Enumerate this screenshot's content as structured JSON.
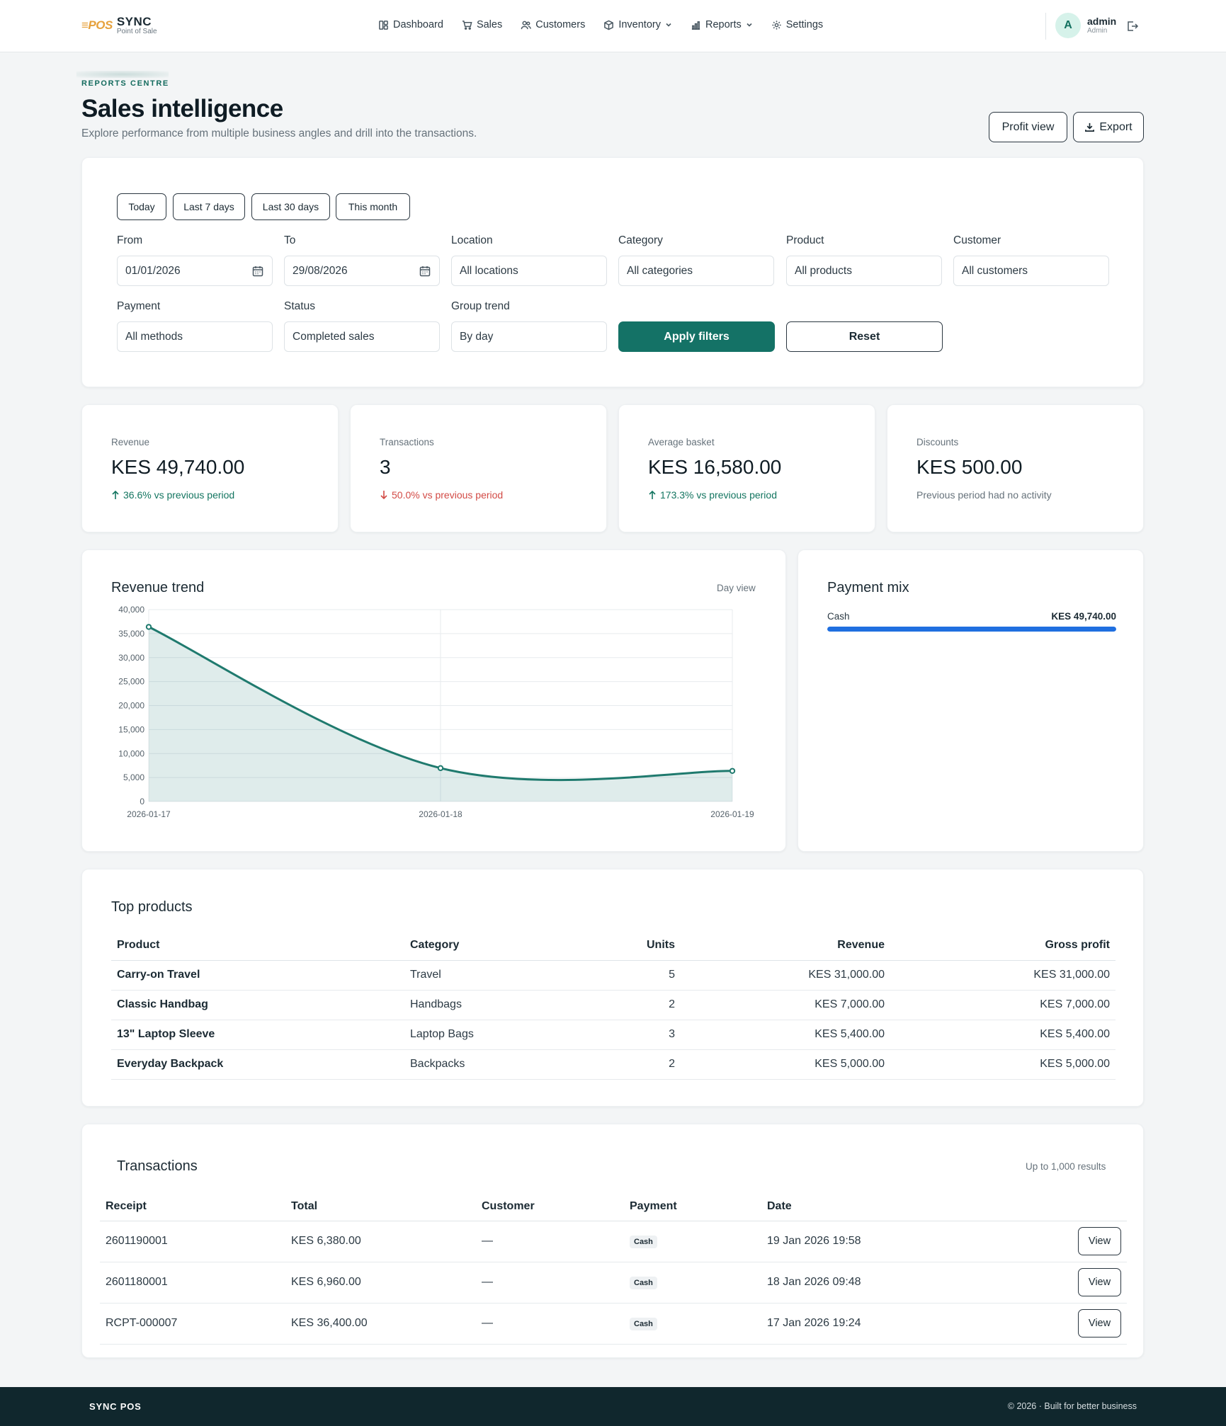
{
  "nav": {
    "brand_logo": "≡POS",
    "brand_name": "SYNC",
    "brand_sub": "Point of Sale",
    "items": [
      {
        "label": "Dashboard",
        "icon": "dashboard-icon"
      },
      {
        "label": "Sales",
        "icon": "cart-icon"
      },
      {
        "label": "Customers",
        "icon": "users-icon"
      },
      {
        "label": "Inventory",
        "icon": "box-icon"
      },
      {
        "label": "Reports",
        "icon": "bar-chart-icon"
      },
      {
        "label": "Settings",
        "icon": "gear-icon"
      }
    ],
    "user": {
      "initial": "A",
      "name": "admin",
      "role": "Admin"
    }
  },
  "header": {
    "eyebrow": "REPORTS CENTRE",
    "title": "Sales intelligence",
    "subtitle": "Explore performance from multiple business angles and drill into the transactions.",
    "profit_label": "Profit view",
    "export_label": "Export"
  },
  "filters": {
    "chips": [
      "Today",
      "Last 7 days",
      "Last 30 days",
      "This month"
    ],
    "from": {
      "label": "From",
      "value": "01/01/2026"
    },
    "to": {
      "label": "To",
      "value": "29/08/2026"
    },
    "location": {
      "label": "Location",
      "value": "All locations"
    },
    "category": {
      "label": "Category",
      "value": "All categories"
    },
    "product": {
      "label": "Product",
      "value": "All products"
    },
    "customer": {
      "label": "Customer",
      "value": "All customers"
    },
    "payment": {
      "label": "Payment",
      "value": "All methods"
    },
    "status": {
      "label": "Status",
      "value": "Completed sales"
    },
    "group": {
      "label": "Group trend",
      "value": "By day"
    },
    "apply_label": "Apply filters",
    "reset_label": "Reset"
  },
  "kpis": [
    {
      "label": "Revenue",
      "value": "KES 49,740.00",
      "delta": "36.6% vs previous period",
      "trend": "up"
    },
    {
      "label": "Transactions",
      "value": "3",
      "delta": "50.0% vs previous period",
      "trend": "down"
    },
    {
      "label": "Average basket",
      "value": "KES 16,580.00",
      "delta": "173.3% vs previous period",
      "trend": "up"
    },
    {
      "label": "Discounts",
      "value": "KES 500.00",
      "delta": "Previous period had no activity",
      "trend": "neutral"
    }
  ],
  "chart_card": {
    "title": "Revenue trend",
    "note": "Day view"
  },
  "chart_data": {
    "type": "area",
    "title": "Revenue trend",
    "x": [
      "2026-01-17",
      "2026-01-18",
      "2026-01-19"
    ],
    "series": [
      {
        "values": [
          36400,
          6960,
          6380
        ]
      }
    ],
    "ylim": [
      0,
      40000
    ],
    "yticks": [
      0,
      5000,
      10000,
      15000,
      20000,
      25000,
      30000,
      35000,
      40000
    ],
    "ytick_labels": [
      "0",
      "5,000",
      "10,000",
      "15,000",
      "20,000",
      "25,000",
      "30,000",
      "35,000",
      "40,000"
    ],
    "grid": true,
    "color": "#1f7a6e"
  },
  "payment_mix": {
    "title": "Payment mix",
    "items": [
      {
        "name": "Cash",
        "amount": "KES 49,740.00",
        "share": 1.0
      }
    ],
    "bar_color": "#1f6fe0"
  },
  "top_products": {
    "title": "Top products",
    "headers": [
      "Product",
      "Category",
      "Units",
      "Revenue",
      "Gross profit"
    ],
    "rows": [
      [
        "Carry-on Travel",
        "Travel",
        "5",
        "KES 31,000.00",
        "KES 31,000.00"
      ],
      [
        "Classic Handbag",
        "Handbags",
        "2",
        "KES 7,000.00",
        "KES 7,000.00"
      ],
      [
        "13\" Laptop Sleeve",
        "Laptop Bags",
        "3",
        "KES 5,400.00",
        "KES 5,400.00"
      ],
      [
        "Everyday Backpack",
        "Backpacks",
        "2",
        "KES 5,000.00",
        "KES 5,000.00"
      ]
    ]
  },
  "transactions": {
    "title": "Transactions",
    "note": "Up to 1,000 results",
    "headers": [
      "Receipt",
      "Total",
      "Customer",
      "Payment",
      "Date"
    ],
    "view_label": "View",
    "rows": [
      [
        "2601190001",
        "KES 6,380.00",
        "—",
        "Cash",
        "19 Jan 2026 19:58"
      ],
      [
        "2601180001",
        "KES 6,960.00",
        "—",
        "Cash",
        "18 Jan 2026 09:48"
      ],
      [
        "RCPT-000007",
        "KES 36,400.00",
        "—",
        "Cash",
        "17 Jan 2026 19:24"
      ]
    ]
  },
  "footer": {
    "brand": "SYNC POS",
    "copy": "© 2026 · Built for better business"
  }
}
